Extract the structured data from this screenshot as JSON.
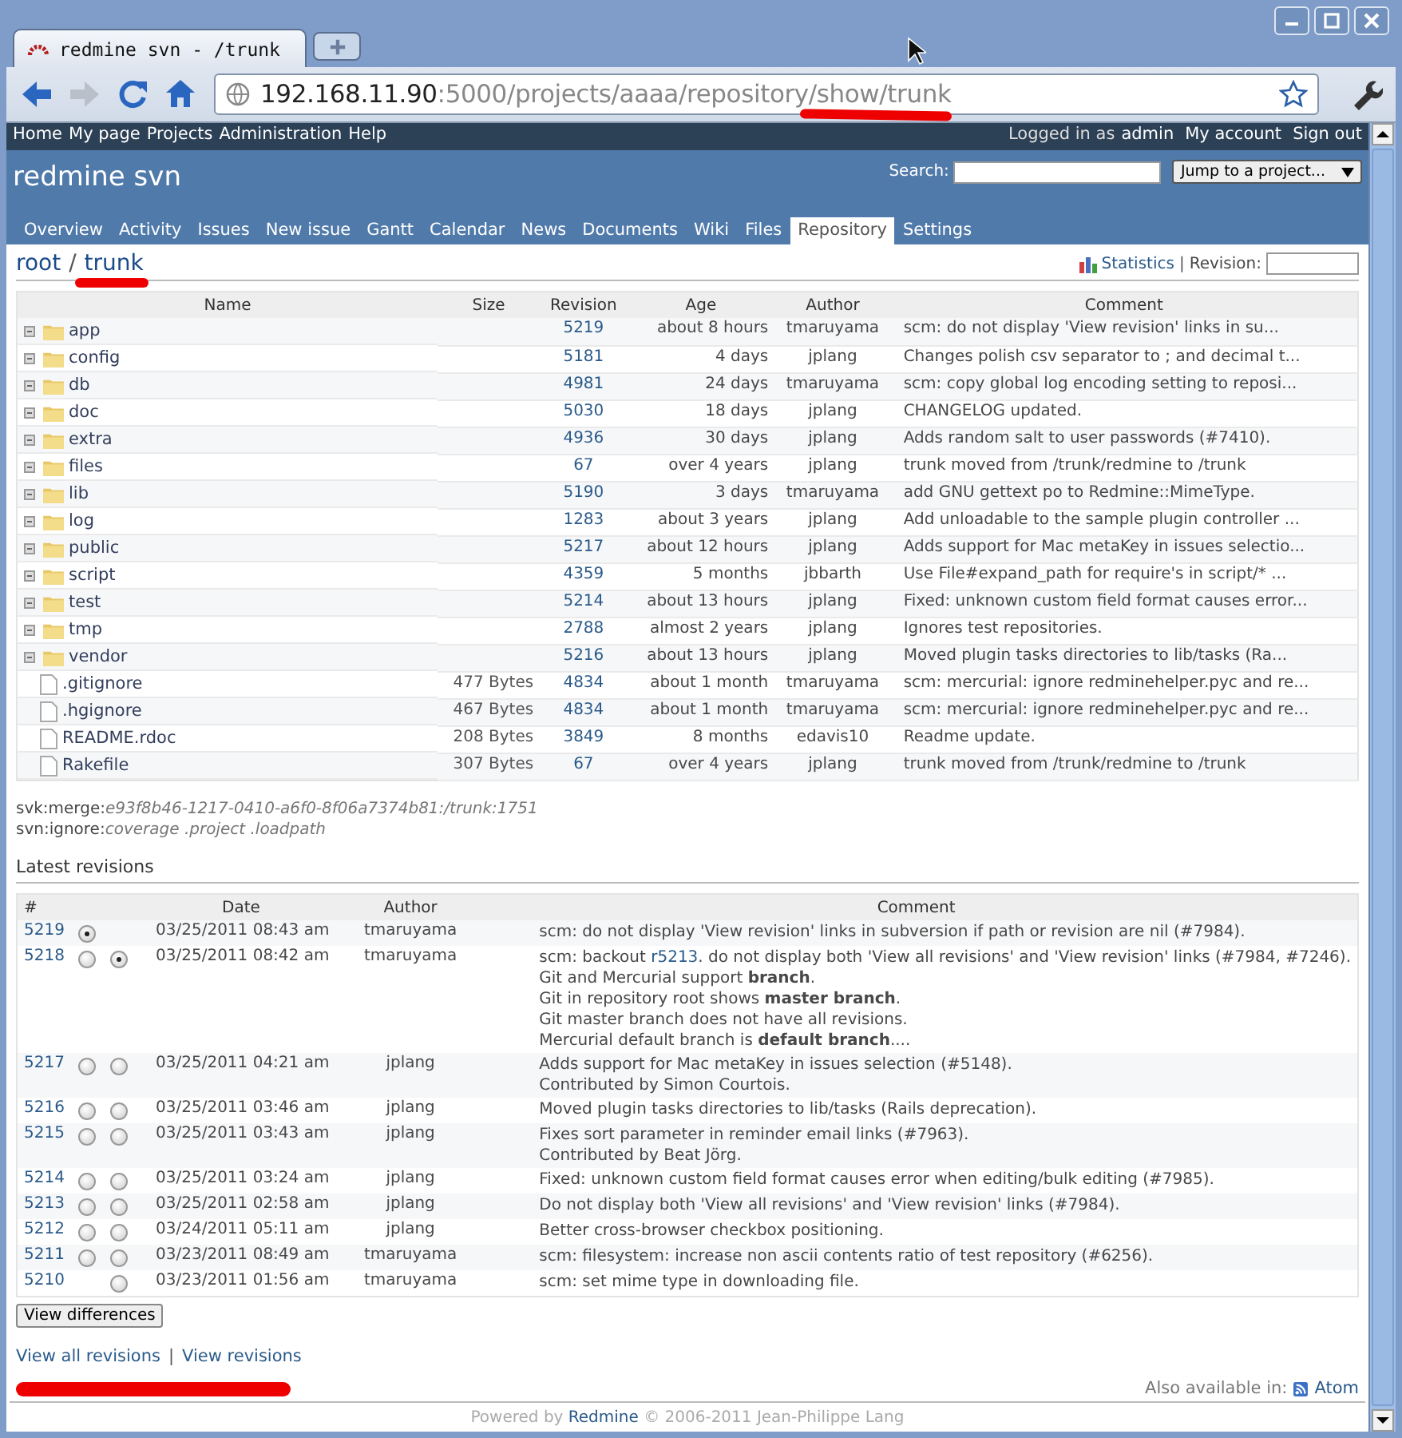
{
  "browser": {
    "tab_title": "redmine svn - /trunk",
    "address_host": "192.168.11.90",
    "address_rest": ":5000/projects/aaaa/repository/show/trunk"
  },
  "top_menu": {
    "left": [
      "Home",
      "My page",
      "Projects",
      "Administration",
      "Help"
    ],
    "logged_in_label": "Logged in as",
    "user": "admin",
    "right": [
      "My account",
      "Sign out"
    ]
  },
  "header": {
    "title": "redmine svn",
    "search_label": "Search:",
    "jump": "Jump to a project..."
  },
  "tabs": [
    {
      "label": "Overview",
      "selected": false
    },
    {
      "label": "Activity",
      "selected": false
    },
    {
      "label": "Issues",
      "selected": false
    },
    {
      "label": "New issue",
      "selected": false
    },
    {
      "label": "Gantt",
      "selected": false
    },
    {
      "label": "Calendar",
      "selected": false
    },
    {
      "label": "News",
      "selected": false
    },
    {
      "label": "Documents",
      "selected": false
    },
    {
      "label": "Wiki",
      "selected": false
    },
    {
      "label": "Files",
      "selected": false
    },
    {
      "label": "Repository",
      "selected": true
    },
    {
      "label": "Settings",
      "selected": false
    }
  ],
  "breadcrumb": {
    "root": "root",
    "separator": "/",
    "current": "trunk",
    "statistics": "Statistics",
    "pipe": "|",
    "revision_label": "Revision:"
  },
  "files": {
    "columns": [
      "Name",
      "Size",
      "Revision",
      "Age",
      "Author",
      "Comment"
    ],
    "rows": [
      {
        "kind": "dir",
        "name": "app",
        "size": "",
        "revision": "5219",
        "age": "about 8 hours",
        "author": "tmaruyama",
        "comment": "scm: do not display 'View revision' links in su..."
      },
      {
        "kind": "dir",
        "name": "config",
        "size": "",
        "revision": "5181",
        "age": "4 days",
        "author": "jplang",
        "comment": "Changes polish csv separator to ; and decimal t..."
      },
      {
        "kind": "dir",
        "name": "db",
        "size": "",
        "revision": "4981",
        "age": "24 days",
        "author": "tmaruyama",
        "comment": "scm: copy global log encoding setting to reposi..."
      },
      {
        "kind": "dir",
        "name": "doc",
        "size": "",
        "revision": "5030",
        "age": "18 days",
        "author": "jplang",
        "comment": "CHANGELOG updated."
      },
      {
        "kind": "dir",
        "name": "extra",
        "size": "",
        "revision": "4936",
        "age": "30 days",
        "author": "jplang",
        "comment": "Adds random salt to user passwords (#7410)."
      },
      {
        "kind": "dir",
        "name": "files",
        "size": "",
        "revision": "67",
        "age": "over 4 years",
        "author": "jplang",
        "comment": "trunk moved from /trunk/redmine to /trunk"
      },
      {
        "kind": "dir",
        "name": "lib",
        "size": "",
        "revision": "5190",
        "age": "3 days",
        "author": "tmaruyama",
        "comment": "add GNU gettext po to Redmine::MimeType."
      },
      {
        "kind": "dir",
        "name": "log",
        "size": "",
        "revision": "1283",
        "age": "about 3 years",
        "author": "jplang",
        "comment": "Add unloadable to the sample plugin controller ..."
      },
      {
        "kind": "dir",
        "name": "public",
        "size": "",
        "revision": "5217",
        "age": "about 12 hours",
        "author": "jplang",
        "comment": "Adds support for Mac metaKey in issues selectio..."
      },
      {
        "kind": "dir",
        "name": "script",
        "size": "",
        "revision": "4359",
        "age": "5 months",
        "author": "jbbarth",
        "comment": "Use File#expand_path for require's in script/* ..."
      },
      {
        "kind": "dir",
        "name": "test",
        "size": "",
        "revision": "5214",
        "age": "about 13 hours",
        "author": "jplang",
        "comment": "Fixed: unknown custom field format causes error..."
      },
      {
        "kind": "dir",
        "name": "tmp",
        "size": "",
        "revision": "2788",
        "age": "almost 2 years",
        "author": "jplang",
        "comment": "Ignores test repositories."
      },
      {
        "kind": "dir",
        "name": "vendor",
        "size": "",
        "revision": "5216",
        "age": "about 13 hours",
        "author": "jplang",
        "comment": "Moved plugin tasks directories to lib/tasks (Ra..."
      },
      {
        "kind": "file",
        "name": ".gitignore",
        "size": "477 Bytes",
        "revision": "4834",
        "age": "about 1 month",
        "author": "tmaruyama",
        "comment": "scm: mercurial: ignore redminehelper.pyc and re..."
      },
      {
        "kind": "file",
        "name": ".hgignore",
        "size": "467 Bytes",
        "revision": "4834",
        "age": "about 1 month",
        "author": "tmaruyama",
        "comment": "scm: mercurial: ignore redminehelper.pyc and re..."
      },
      {
        "kind": "file",
        "name": "README.rdoc",
        "size": "208 Bytes",
        "revision": "3849",
        "age": "8 months",
        "author": "edavis10",
        "comment": "Readme update."
      },
      {
        "kind": "file",
        "name": "Rakefile",
        "size": "307 Bytes",
        "revision": "67",
        "age": "over 4 years",
        "author": "jplang",
        "comment": "trunk moved from /trunk/redmine to /trunk"
      }
    ]
  },
  "properties": [
    {
      "name": "svk:merge:",
      "value": "e93f8b46-1217-0410-a6f0-8f06a7374b81:/trunk:1751"
    },
    {
      "name": "svn:ignore:",
      "value": "coverage .project .loadpath"
    }
  ],
  "revisions": {
    "title": "Latest revisions",
    "columns": [
      "#",
      "Date",
      "Author",
      "Comment"
    ],
    "rows": [
      {
        "rev": "5219",
        "radio_a": {
          "selected": true
        },
        "date": "03/25/2011 08:43 am",
        "author": "tmaruyama",
        "lines": [
          "scm: do not display 'View revision' links in subversion if path or revision are nil (#7984)."
        ]
      },
      {
        "rev": "5218",
        "radio_a": {
          "selected": false
        },
        "radio_b": {
          "selected": true
        },
        "date": "03/25/2011 08:42 am",
        "author": "tmaruyama",
        "lines": [
          {
            "before": "scm: backout ",
            "link": "r5213",
            "after": ". do not display both 'View all revisions' and 'View revision' links (#7984, #7246)."
          },
          "Git and Mercurial support **branch**.",
          "Git in repository root shows **master branch**.",
          "Git master branch does not have all revisions.",
          "Mercurial default branch is **default branch**...."
        ]
      },
      {
        "rev": "5217",
        "radio_a": {
          "selected": false
        },
        "radio_b": {
          "selected": false
        },
        "date": "03/25/2011 04:21 am",
        "author": "jplang",
        "lines": [
          "Adds support for Mac metaKey in issues selection (#5148).",
          "Contributed by Simon Courtois."
        ]
      },
      {
        "rev": "5216",
        "radio_a": {
          "selected": false
        },
        "radio_b": {
          "selected": false
        },
        "date": "03/25/2011 03:46 am",
        "author": "jplang",
        "lines": [
          "Moved plugin tasks directories to lib/tasks (Rails deprecation)."
        ]
      },
      {
        "rev": "5215",
        "radio_a": {
          "selected": false
        },
        "radio_b": {
          "selected": false
        },
        "date": "03/25/2011 03:43 am",
        "author": "jplang",
        "lines": [
          "Fixes sort parameter in reminder email links (#7963).",
          "Contributed by Beat Jörg."
        ]
      },
      {
        "rev": "5214",
        "radio_a": {
          "selected": false
        },
        "radio_b": {
          "selected": false
        },
        "date": "03/25/2011 03:24 am",
        "author": "jplang",
        "lines": [
          "Fixed: unknown custom field format causes error when editing/bulk editing (#7985)."
        ]
      },
      {
        "rev": "5213",
        "radio_a": {
          "selected": false
        },
        "radio_b": {
          "selected": false
        },
        "date": "03/25/2011 02:58 am",
        "author": "jplang",
        "lines": [
          "Do not display both 'View all revisions' and 'View revision' links (#7984)."
        ]
      },
      {
        "rev": "5212",
        "radio_a": {
          "selected": false
        },
        "radio_b": {
          "selected": false
        },
        "date": "03/24/2011 05:11 am",
        "author": "jplang",
        "lines": [
          "Better cross-browser checkbox positioning."
        ]
      },
      {
        "rev": "5211",
        "radio_a": {
          "selected": false
        },
        "radio_b": {
          "selected": false
        },
        "date": "03/23/2011 08:49 am",
        "author": "tmaruyama",
        "lines": [
          "scm: filesystem: increase non ascii contents ratio of test repository (#6256)."
        ]
      },
      {
        "rev": "5210",
        "radio_b": {
          "selected": false
        },
        "date": "03/23/2011 01:56 am",
        "author": "tmaruyama",
        "lines": [
          "scm: set mime type in downloading file."
        ]
      }
    ],
    "diff_button": "View differences",
    "links": [
      "View all revisions",
      "View revisions"
    ],
    "link_separator": "|"
  },
  "also_available": {
    "label": "Also available in:",
    "formats": [
      "Atom"
    ]
  },
  "footer": {
    "before": "Powered by",
    "link": "Redmine",
    "after": "© 2006-2011 Jean-Philippe Lang"
  }
}
